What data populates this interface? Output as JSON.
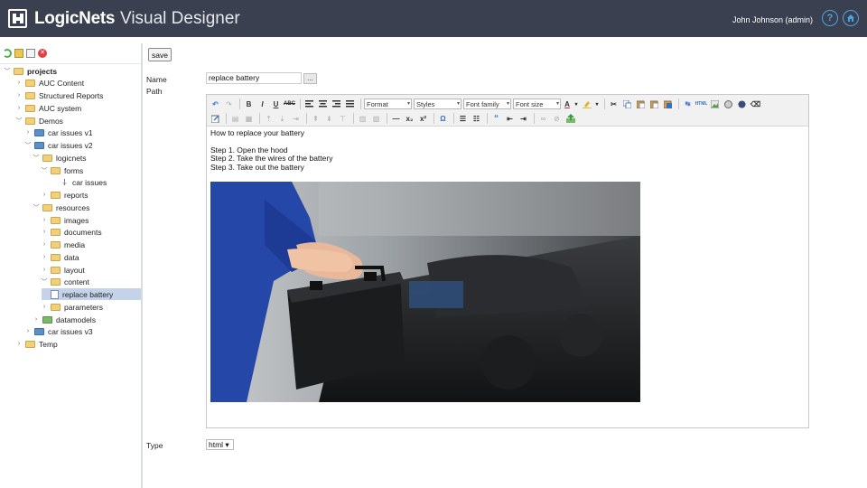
{
  "header": {
    "brand": "LogicNets",
    "app_title": "Visual Designer",
    "user": "John Johnson (admin)",
    "help_icon": "?",
    "home_icon": "home-icon",
    "colors": {
      "bar": "#3a4050",
      "accent": "#4fa3e0"
    }
  },
  "sidebar": {
    "tools": [
      "refresh-icon",
      "open-folder-icon",
      "new-file-icon",
      "delete-icon"
    ],
    "tree": [
      {
        "label": "projects",
        "icon": "folder",
        "expanded": true,
        "bold": true
      },
      {
        "label": "AUC Content",
        "icon": "folder",
        "expanded": false
      },
      {
        "label": "Structured Reports",
        "icon": "folder",
        "expanded": false
      },
      {
        "label": "AUC system",
        "icon": "folder",
        "expanded": false
      },
      {
        "label": "Demos",
        "icon": "folder",
        "expanded": true
      },
      {
        "label": "car issues v1",
        "icon": "blue-folder",
        "expanded": false
      },
      {
        "label": "car issues v2",
        "icon": "blue-folder",
        "expanded": true
      },
      {
        "label": "logicnets",
        "icon": "folder",
        "expanded": true
      },
      {
        "label": "forms",
        "icon": "folder",
        "expanded": true
      },
      {
        "label": "car issues",
        "icon": "node"
      },
      {
        "label": "reports",
        "icon": "folder",
        "expanded": false
      },
      {
        "label": "resources",
        "icon": "folder",
        "expanded": true
      },
      {
        "label": "images",
        "icon": "folder",
        "expanded": false
      },
      {
        "label": "documents",
        "icon": "folder",
        "expanded": false
      },
      {
        "label": "media",
        "icon": "folder",
        "expanded": false
      },
      {
        "label": "data",
        "icon": "folder",
        "expanded": false
      },
      {
        "label": "layout",
        "icon": "folder",
        "expanded": false
      },
      {
        "label": "content",
        "icon": "folder",
        "expanded": true
      },
      {
        "label": "replace battery",
        "icon": "page",
        "selected": true
      },
      {
        "label": "parameters",
        "icon": "folder",
        "expanded": false
      },
      {
        "label": "datamodels",
        "icon": "green-folder",
        "expanded": false
      },
      {
        "label": "car issues v3",
        "icon": "blue-folder",
        "expanded": false
      },
      {
        "label": "Temp",
        "icon": "folder",
        "expanded": false
      }
    ]
  },
  "form": {
    "save_label": "save",
    "name_label": "Name",
    "name_value": "replace battery",
    "browse_label": "...",
    "path_label": "Path",
    "type_label": "Type",
    "type_value": "html ▾"
  },
  "editor": {
    "toolbar": {
      "undo": "↶",
      "redo": "↷",
      "bold": "B",
      "italic": "I",
      "underline": "U",
      "strike": "ABC",
      "format": "Format",
      "styles": "Styles",
      "font_family": "Font family",
      "font_size": "Font size",
      "text_color": "A",
      "hr": "—",
      "subscript": "x₂",
      "superscript": "x²",
      "omega": "Ω",
      "quote": "“",
      "html": "HTML"
    },
    "content": {
      "title": "How to replace your battery",
      "steps": [
        "Step 1. Open the hood",
        "Step 2. Take the wires of the battery",
        "Step 3. Take out the battery"
      ]
    }
  }
}
